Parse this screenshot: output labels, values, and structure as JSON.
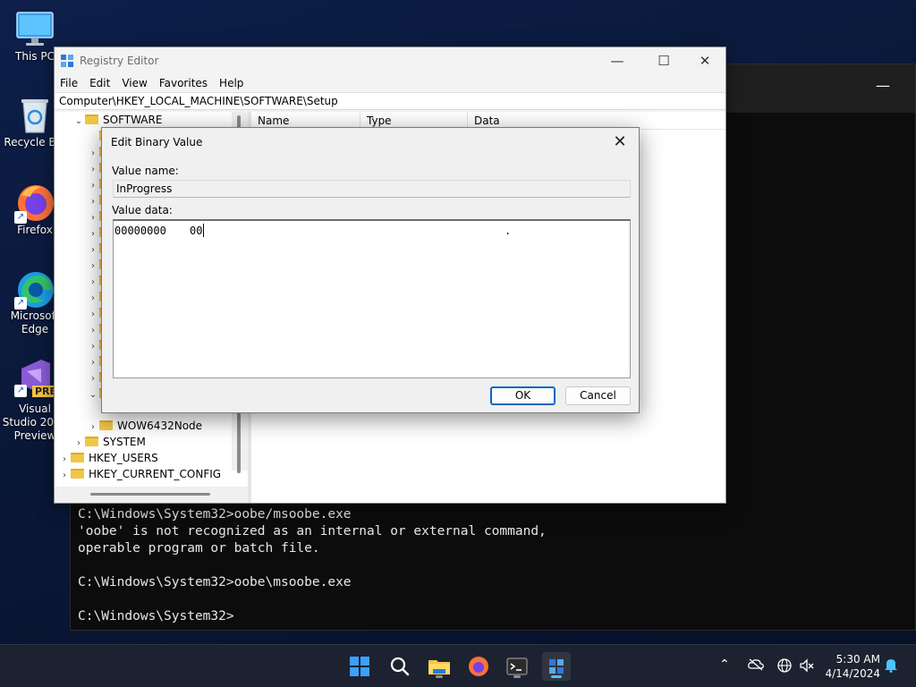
{
  "desktop": {
    "icons": [
      {
        "label": "This PC"
      },
      {
        "label": "Recycle Bin"
      },
      {
        "label": "Firefox"
      },
      {
        "label": "Microsoft Edge"
      },
      {
        "label": "Visual Studio 2022 Preview"
      }
    ],
    "vs_badge": "PRE"
  },
  "console": {
    "lines": "C:\\Windows\\System32>oobe/msoobe.exe\n'oobe' is not recognized as an internal or external command,\noperable program or batch file.\n\nC:\\Windows\\System32>oobe\\msoobe.exe\n\nC:\\Windows\\System32>"
  },
  "regedit": {
    "title": "Registry Editor",
    "menu": [
      "File",
      "Edit",
      "View",
      "Favorites",
      "Help"
    ],
    "address": "Computer\\HKEY_LOCAL_MACHINE\\SOFTWARE\\Setup",
    "tree": {
      "software": "SOFTWARE",
      "wow": "WOW6432Node",
      "system": "SYSTEM",
      "users": "HKEY_USERS",
      "current_config": "HKEY_CURRENT_CONFIG"
    },
    "columns": [
      "Name",
      "Type",
      "Data"
    ]
  },
  "dialog": {
    "title": "Edit Binary Value",
    "value_name_label": "Value name:",
    "value_name": "InProgress",
    "value_data_label": "Value data:",
    "data_offset": "00000000",
    "data_hex": "00",
    "data_ascii": ".",
    "ok_label": "OK",
    "cancel_label": "Cancel"
  },
  "taskbar": {
    "time": "5:30 AM",
    "date": "4/14/2024"
  },
  "colors": {
    "accent": "#0067c0",
    "folder": "#f2c744",
    "taskbar_indicator": "#4cc2ff"
  }
}
